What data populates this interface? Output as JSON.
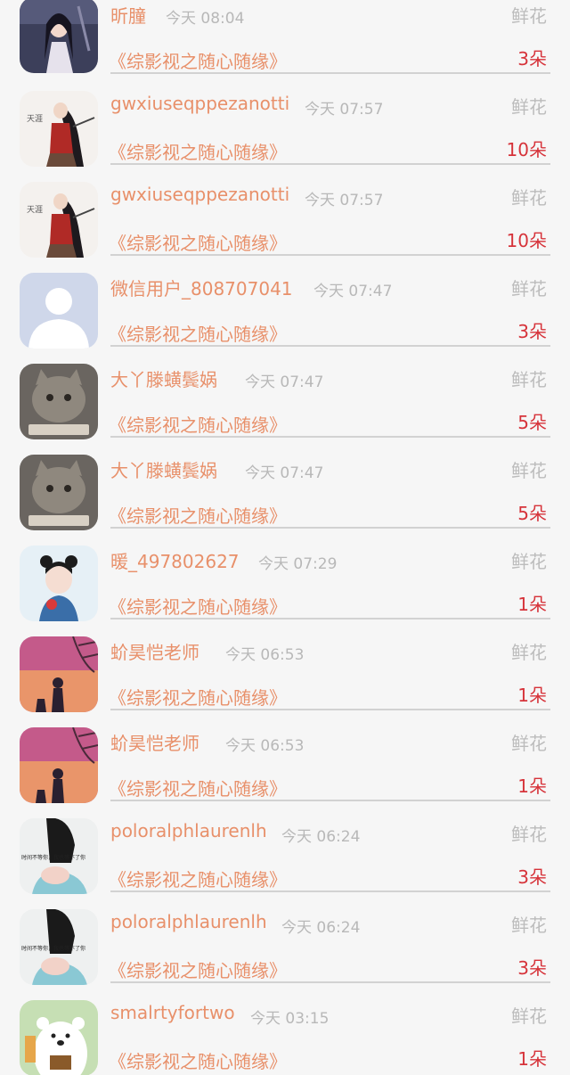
{
  "gift_label": "鲜花",
  "book_title": "《综影视之随心随缘》",
  "rows": [
    {
      "user": "昕朣",
      "time": "今天 08:04",
      "count": "3朵",
      "avatar": "girl-hanfu"
    },
    {
      "user": "gwxiuseqppezanotti",
      "time": "今天 07:57",
      "count": "10朵",
      "avatar": "warrior"
    },
    {
      "user": "gwxiuseqppezanotti",
      "time": "今天 07:57",
      "count": "10朵",
      "avatar": "warrior"
    },
    {
      "user": "微信用户_808707041",
      "time": "今天 07:47",
      "count": "3朵",
      "avatar": "default-user"
    },
    {
      "user": "大丫滕蟥鬓娲",
      "time": "今天 07:47",
      "count": "5朵",
      "avatar": "cat"
    },
    {
      "user": "大丫滕蟥鬓娲",
      "time": "今天 07:47",
      "count": "5朵",
      "avatar": "cat"
    },
    {
      "user": "暖_497802627",
      "time": "今天 07:29",
      "count": "1朵",
      "avatar": "girl-flowers"
    },
    {
      "user": "蚧昊恺老师",
      "time": "今天 06:53",
      "count": "1朵",
      "avatar": "sunset"
    },
    {
      "user": "蚧昊恺老师",
      "time": "今天 06:53",
      "count": "1朵",
      "avatar": "sunset"
    },
    {
      "user": "poloralphlaurenlh",
      "time": "今天 06:24",
      "count": "3朵",
      "avatar": "hand-text"
    },
    {
      "user": "poloralphlaurenlh",
      "time": "今天 06:24",
      "count": "3朵",
      "avatar": "hand-text"
    },
    {
      "user": "smalrtyfortwo",
      "time": "今天 03:15",
      "count": "1朵",
      "avatar": "bear"
    }
  ],
  "avatar_text": {
    "warrior": "天涯",
    "hand-text": "时间不等你，我也等不了你"
  }
}
